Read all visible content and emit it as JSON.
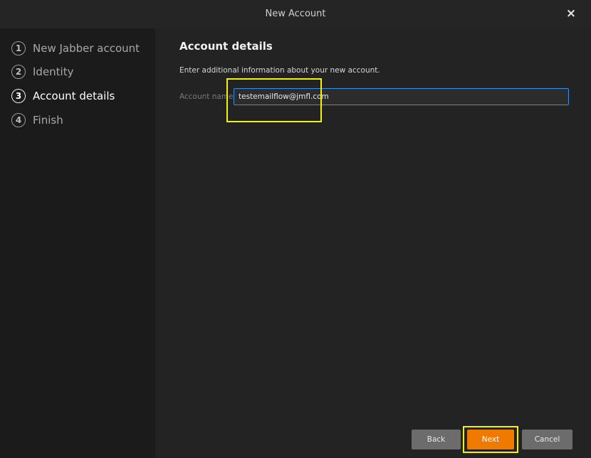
{
  "window": {
    "title": "New Account",
    "close_icon": "×"
  },
  "steps": [
    {
      "number": "1",
      "label": "New Jabber account",
      "active": false
    },
    {
      "number": "2",
      "label": "Identity",
      "active": false
    },
    {
      "number": "3",
      "label": "Account details",
      "active": true
    },
    {
      "number": "4",
      "label": "Finish",
      "active": false
    }
  ],
  "main": {
    "title": "Account details",
    "description": "Enter additional information about your new account.",
    "account_name_label": "Account name",
    "account_name_value": "testemailflow@jmfl.com"
  },
  "buttons": {
    "back": "Back",
    "next": "Next",
    "cancel": "Cancel"
  },
  "colors": {
    "accent": "#f07a00",
    "highlight": "#f2f20a",
    "focus": "#3d8ee0"
  }
}
